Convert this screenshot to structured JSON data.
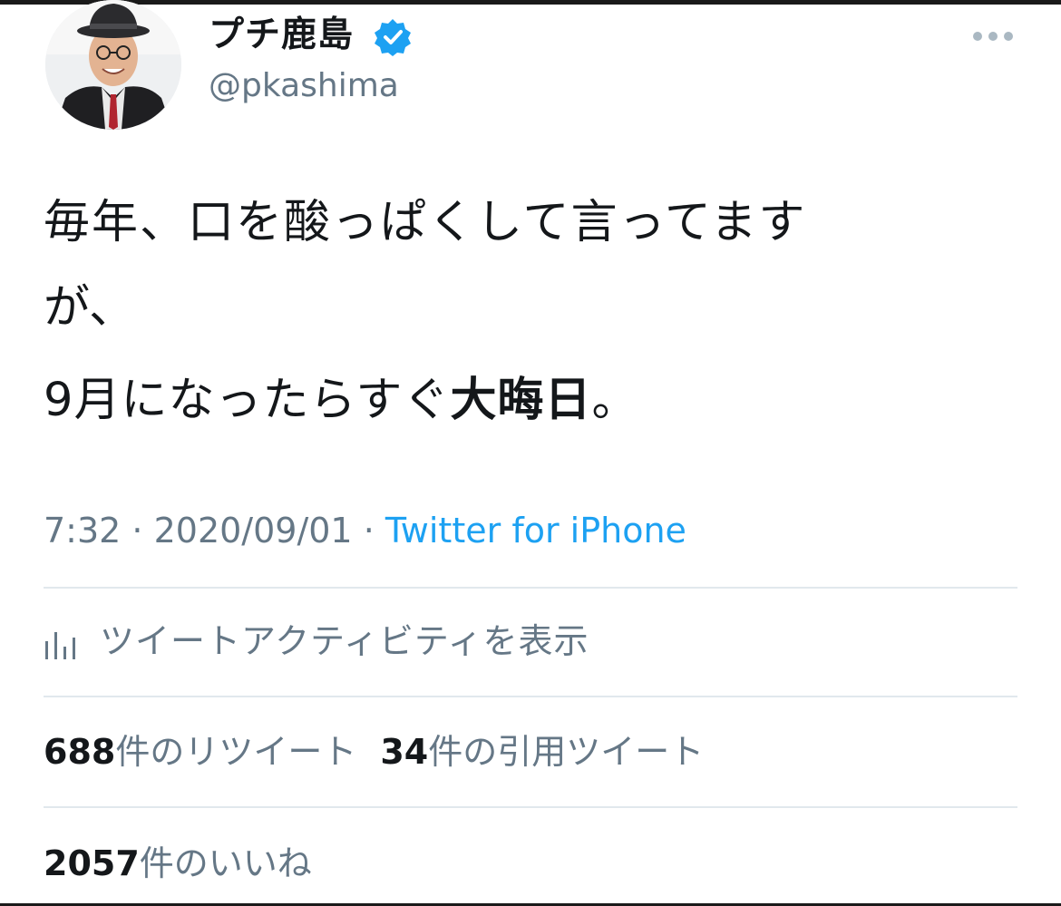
{
  "author": {
    "display_name": "プチ鹿島",
    "handle": "@pkashima",
    "verified_color": "#1da1f2"
  },
  "tweet": {
    "line1": "毎年、口を酸っぱくして言ってます",
    "line2": "が、",
    "line3_normal": "9月になったらすぐ",
    "line3_bold": "大晦日",
    "line3_end": "。"
  },
  "meta": {
    "time": "7:32",
    "date": "2020/09/01",
    "source": "Twitter for iPhone",
    "separator": " · "
  },
  "activity": {
    "label": "ツイートアクティビティを表示",
    "icon": "analytics-icon"
  },
  "stats": {
    "retweets_count": "688",
    "retweets_label": "件のリツイート",
    "quotes_count": "34",
    "quotes_label": "件の引用ツイート",
    "likes_count": "2057",
    "likes_label": "件のいいね"
  },
  "colors": {
    "text": "#14171a",
    "secondary": "#657786",
    "link": "#1da1f2",
    "divider": "#e1e8ed"
  }
}
